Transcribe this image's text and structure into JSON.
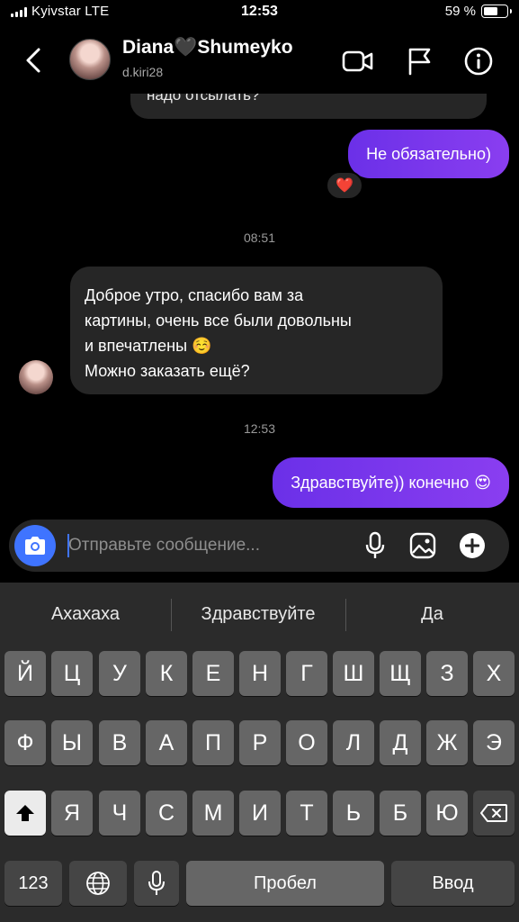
{
  "status_bar": {
    "carrier": "Kyivstar  LTE",
    "time": "12:53",
    "battery_percent_label": "59 %",
    "battery_level": 0.59
  },
  "header": {
    "contact_name": "Diana🖤Shumeyko",
    "contact_handle": "d.kiri28"
  },
  "chat": {
    "previous_message_fragment": "надо отсылать?",
    "messages": [
      {
        "direction": "out",
        "text": "Не обязательно)",
        "reaction": "❤️"
      },
      {
        "timestamp": "08:51"
      },
      {
        "direction": "in",
        "lines": [
          "Доброе утро, спасибо вам за",
          "картины, очень все были довольны",
          "и впечатлены ☺️",
          "Можно заказать ещё?"
        ]
      },
      {
        "timestamp": "12:53"
      },
      {
        "direction": "out",
        "text": "Здравствуйте)) конечно",
        "emoji": "😍"
      }
    ]
  },
  "composer": {
    "placeholder": "Отправьте сообщение..."
  },
  "keyboard": {
    "suggestions": [
      "Ахахаха",
      "Здравствуйте",
      "Да"
    ],
    "row1": [
      "Й",
      "Ц",
      "У",
      "К",
      "Е",
      "Н",
      "Г",
      "Ш",
      "Щ",
      "З",
      "Х"
    ],
    "row2": [
      "Ф",
      "Ы",
      "В",
      "А",
      "П",
      "Р",
      "О",
      "Л",
      "Д",
      "Ж",
      "Э"
    ],
    "row3": [
      "Я",
      "Ч",
      "С",
      "М",
      "И",
      "Т",
      "Ь",
      "Б",
      "Ю"
    ],
    "numbers_key": "123",
    "space_key": "Пробел",
    "return_key": "Ввод"
  },
  "colors": {
    "accent_blue": "#3f74ff",
    "outgoing_bubble": "#7a37ec",
    "incoming_bubble": "#262626"
  },
  "icons": [
    "back-icon",
    "video-call-icon",
    "flag-icon",
    "info-icon",
    "camera-icon",
    "microphone-icon",
    "gallery-icon",
    "sticker-icon",
    "shift-icon",
    "backspace-icon",
    "globe-icon",
    "dictation-icon"
  ]
}
